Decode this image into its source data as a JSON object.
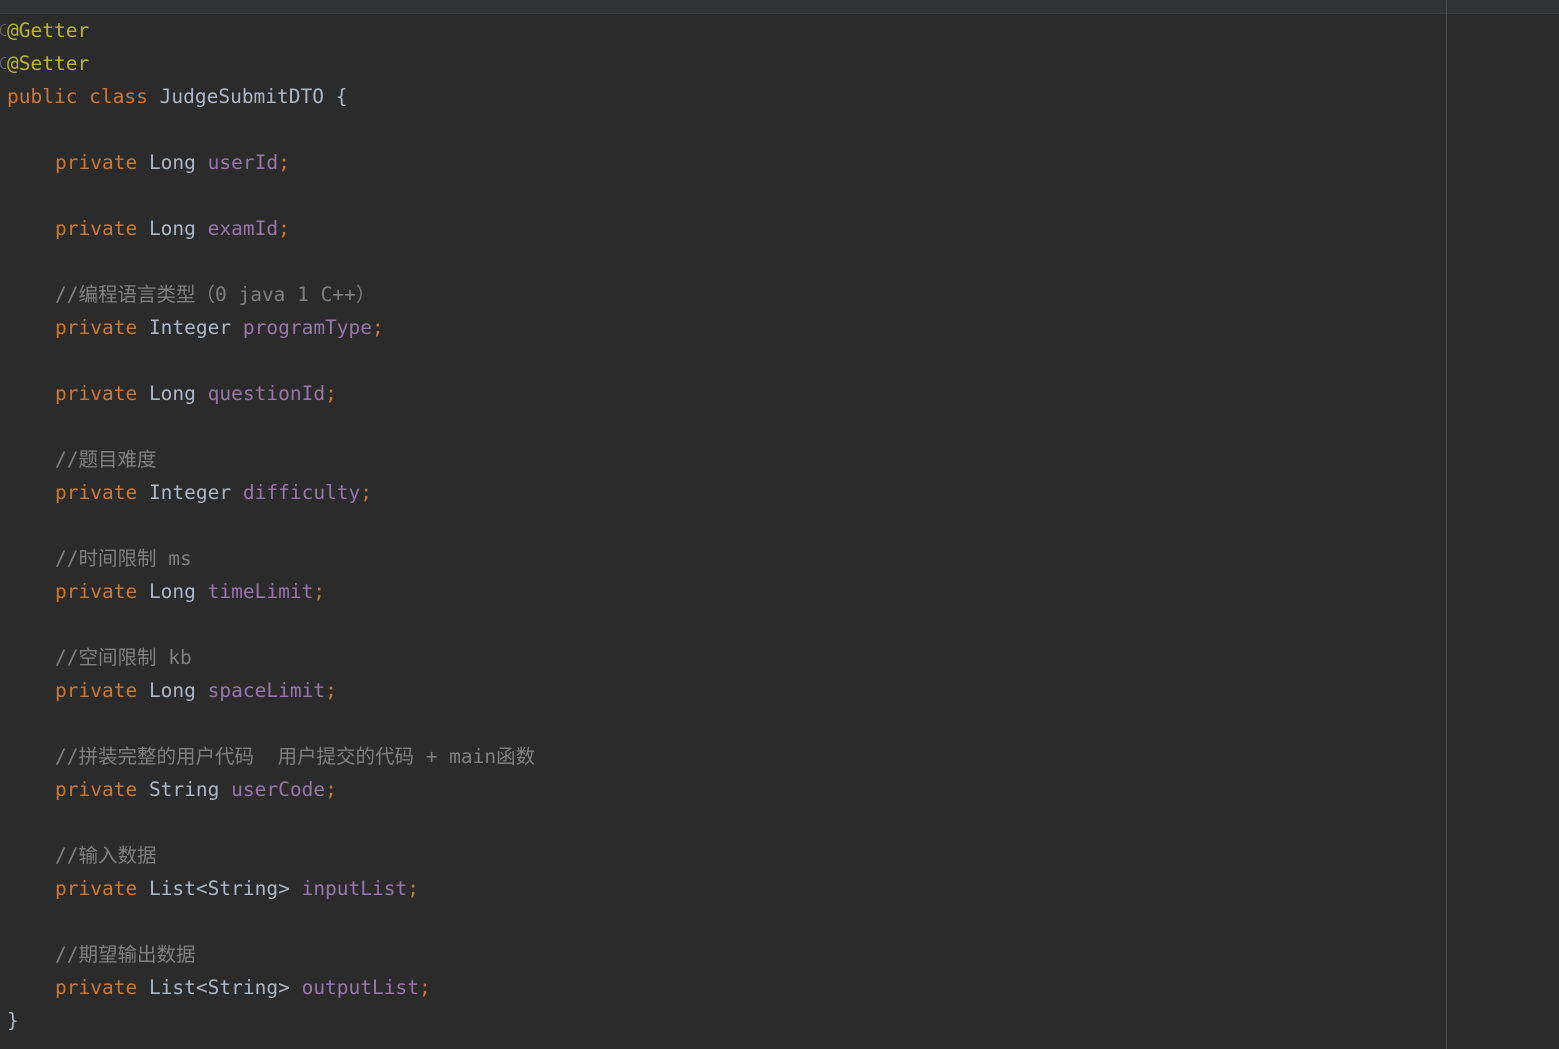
{
  "editor": {
    "language": "java",
    "lines": [
      {
        "type": "annotation",
        "text": "@Getter"
      },
      {
        "type": "annotation",
        "text": "@Setter"
      },
      {
        "type": "class_decl",
        "keywords": "public class",
        "name": "JudgeSubmitDTO",
        "brace": "{"
      },
      {
        "type": "blank"
      },
      {
        "type": "field",
        "modifier": "private",
        "field_type": "Long",
        "name": "userId",
        "semi": ";"
      },
      {
        "type": "blank"
      },
      {
        "type": "field",
        "modifier": "private",
        "field_type": "Long",
        "name": "examId",
        "semi": ";"
      },
      {
        "type": "blank"
      },
      {
        "type": "comment",
        "text": "//编程语言类型（0 java 1 C++）"
      },
      {
        "type": "field",
        "modifier": "private",
        "field_type": "Integer",
        "name": "programType",
        "semi": ";"
      },
      {
        "type": "blank"
      },
      {
        "type": "field",
        "modifier": "private",
        "field_type": "Long",
        "name": "questionId",
        "semi": ";"
      },
      {
        "type": "blank"
      },
      {
        "type": "comment",
        "text": "//题目难度"
      },
      {
        "type": "field",
        "modifier": "private",
        "field_type": "Integer",
        "name": "difficulty",
        "semi": ";"
      },
      {
        "type": "blank"
      },
      {
        "type": "comment",
        "text": "//时间限制 ms"
      },
      {
        "type": "field",
        "modifier": "private",
        "field_type": "Long",
        "name": "timeLimit",
        "semi": ";"
      },
      {
        "type": "blank"
      },
      {
        "type": "comment",
        "text": "//空间限制 kb"
      },
      {
        "type": "field",
        "modifier": "private",
        "field_type": "Long",
        "name": "spaceLimit",
        "semi": ";"
      },
      {
        "type": "blank"
      },
      {
        "type": "comment",
        "text": "//拼装完整的用户代码  用户提交的代码 + main函数"
      },
      {
        "type": "field",
        "modifier": "private",
        "field_type": "String",
        "name": "userCode",
        "semi": ";"
      },
      {
        "type": "blank"
      },
      {
        "type": "comment",
        "text": "//输入数据"
      },
      {
        "type": "field",
        "modifier": "private",
        "field_type": "List<String>",
        "name": "inputList",
        "semi": ";"
      },
      {
        "type": "blank"
      },
      {
        "type": "comment",
        "text": "//期望输出数据"
      },
      {
        "type": "field",
        "modifier": "private",
        "field_type": "List<String>",
        "name": "outputList",
        "semi": ";"
      },
      {
        "type": "close",
        "text": "}"
      }
    ]
  },
  "colors": {
    "background": "#2b2b2b",
    "keyword": "#cc7832",
    "annotation": "#bbb529",
    "field": "#9876aa",
    "comment": "#808080",
    "text": "#a9b7c6"
  }
}
